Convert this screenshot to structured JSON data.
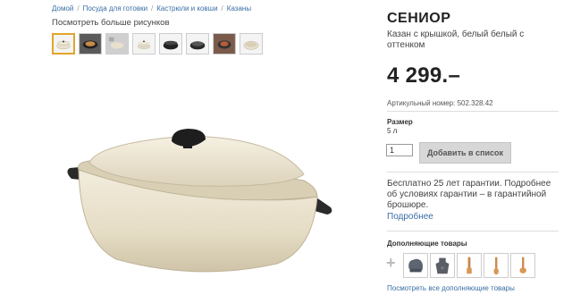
{
  "breadcrumb": {
    "items": [
      "Домой",
      "Посуда для готовки",
      "Кастрюли и ковши",
      "Казаны"
    ]
  },
  "gallery": {
    "more_label": "Посмотреть больше рисунков",
    "thumbnails": [
      "pot-cream",
      "pot-dark-cooking",
      "pot-kitchen",
      "pot-side",
      "pot-dark",
      "pot-dark-open",
      "pot-food",
      "pot-cream-lid"
    ]
  },
  "product": {
    "name": "СЕНИОР",
    "description": "Казан с крышкой, белый белый с оттенком",
    "price": "4 299.–",
    "article": "Артикульный номер: 502.328.42",
    "size_label": "Размер",
    "size_value": "5 л",
    "quantity": "1",
    "add_button": "Добавить в список"
  },
  "warranty": {
    "text": "Бесплатно 25 лет гарантии. Подробнее об условиях гарантии – в гарантийной брошюре.",
    "more_link": "Подробнее"
  },
  "extras": {
    "title": "Дополняющие товары",
    "items": [
      "oven-mitt-icon",
      "apron-icon",
      "spatula-icon",
      "wooden-spoon-icon",
      "wooden-ladle-icon"
    ],
    "view_all": "Посмотреть все дополняющие товары"
  },
  "colors": {
    "link": "#3a6ea5",
    "accent": "#e0a52b",
    "pot_cream": "#e8e0cc"
  }
}
